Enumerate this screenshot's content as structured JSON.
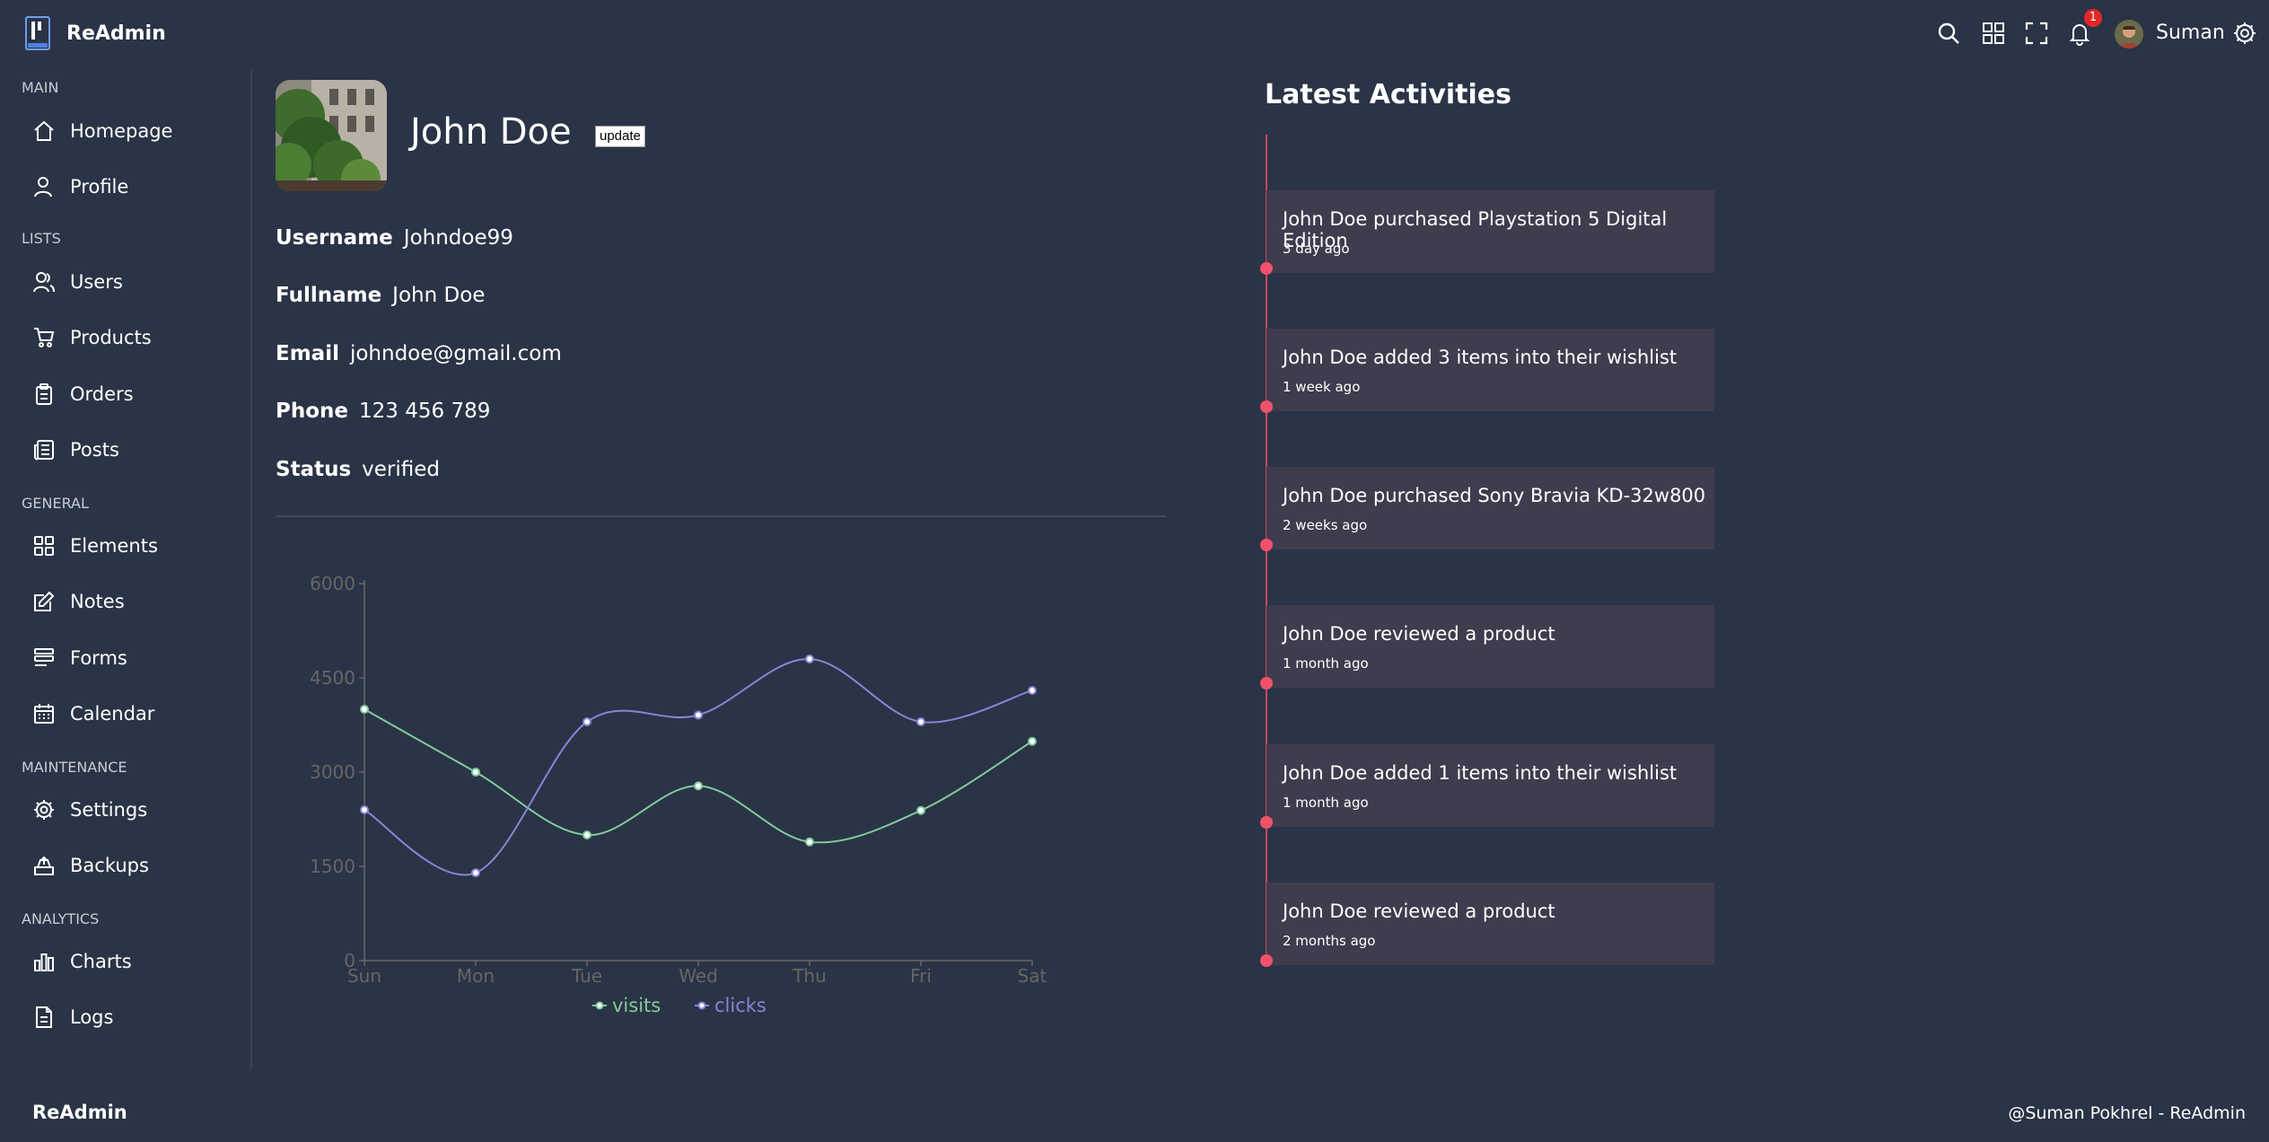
{
  "app": {
    "name": "ReAdmin"
  },
  "navbar": {
    "user_name": "Suman",
    "notification_count": "1",
    "icons": [
      "search-icon",
      "grid-icon",
      "fullscreen-icon",
      "bell-icon",
      "gear-icon"
    ]
  },
  "sidebar": {
    "sections": [
      {
        "title": "MAIN",
        "items": [
          {
            "label": "Homepage",
            "icon": "home-icon"
          },
          {
            "label": "Profile",
            "icon": "user-icon"
          }
        ]
      },
      {
        "title": "LISTS",
        "items": [
          {
            "label": "Users",
            "icon": "users-icon"
          },
          {
            "label": "Products",
            "icon": "cart-icon"
          },
          {
            "label": "Orders",
            "icon": "clipboard-icon"
          },
          {
            "label": "Posts",
            "icon": "newspaper-icon"
          }
        ]
      },
      {
        "title": "GENERAL",
        "items": [
          {
            "label": "Elements",
            "icon": "grid-icon"
          },
          {
            "label": "Notes",
            "icon": "edit-icon"
          },
          {
            "label": "Forms",
            "icon": "forms-icon"
          },
          {
            "label": "Calendar",
            "icon": "calendar-icon"
          }
        ]
      },
      {
        "title": "MAINTENANCE",
        "items": [
          {
            "label": "Settings",
            "icon": "gear-icon"
          },
          {
            "label": "Backups",
            "icon": "backup-icon"
          }
        ]
      },
      {
        "title": "ANALYTICS",
        "items": [
          {
            "label": "Charts",
            "icon": "bar-chart-icon"
          },
          {
            "label": "Logs",
            "icon": "file-icon"
          }
        ]
      }
    ]
  },
  "profile": {
    "name": "John Doe",
    "update_label": "update",
    "fields": [
      {
        "key": "Username",
        "value": "Johndoe99"
      },
      {
        "key": "Fullname",
        "value": "John Doe"
      },
      {
        "key": "Email",
        "value": "johndoe@gmail.com"
      },
      {
        "key": "Phone",
        "value": "123 456 789"
      },
      {
        "key": "Status",
        "value": "verified"
      }
    ]
  },
  "chart_data": {
    "type": "line",
    "categories": [
      "Sun",
      "Mon",
      "Tue",
      "Wed",
      "Thu",
      "Fri",
      "Sat"
    ],
    "series": [
      {
        "name": "visits",
        "color": "#82ca9d",
        "values": [
          4000,
          3000,
          2000,
          2780,
          1890,
          2390,
          3490
        ]
      },
      {
        "name": "clicks",
        "color": "#8884d8",
        "values": [
          2400,
          1398,
          3800,
          3908,
          4800,
          3800,
          4300
        ]
      }
    ],
    "ylim": [
      0,
      6000
    ],
    "yticks": [
      0,
      1500,
      3000,
      4500,
      6000
    ],
    "grid": false,
    "legend": "bottom"
  },
  "activities": {
    "title": "Latest Activities",
    "items": [
      {
        "text": "John Doe purchased Playstation 5 Digital Edition",
        "time": "3 day ago"
      },
      {
        "text": "John Doe added 3 items into their wishlist",
        "time": "1 week ago"
      },
      {
        "text": "John Doe purchased Sony Bravia KD-32w800",
        "time": "2 weeks ago"
      },
      {
        "text": "John Doe reviewed a product",
        "time": "1 month ago"
      },
      {
        "text": "John Doe added 1 items into their wishlist",
        "time": "1 month ago"
      },
      {
        "text": "John Doe reviewed a product",
        "time": "2 months ago"
      }
    ]
  },
  "footer": {
    "left": "ReAdmin",
    "right": "@Suman Pokhrel - ReAdmin"
  }
}
